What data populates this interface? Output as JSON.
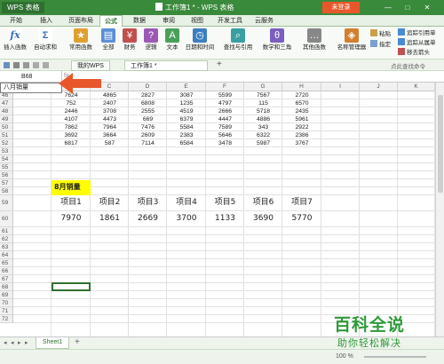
{
  "titlebar": {
    "app": "WPS 表格",
    "title": "工作簿1 * - WPS 表格",
    "login": "未登录",
    "controls": [
      "—",
      "□",
      "✕"
    ],
    "colors": {
      "bar": "#3a8a3c",
      "login": "#e8572b"
    }
  },
  "menu": [
    "开始",
    "插入",
    "页面布局",
    "公式",
    "数据",
    "审阅",
    "视图",
    "开发工具",
    "云服务"
  ],
  "menu_active": "公式",
  "ribbon": {
    "insert_function": "插入函数",
    "autosum": "自动求和",
    "common_functions": "常用函数",
    "all": "全部",
    "finance": "财务",
    "logic": "逻辑",
    "text": "文本",
    "datetime": "日期和时间",
    "lookup": "查找与引用",
    "math_trig": "数学和三角",
    "other_functions": "其他函数",
    "name_manager": "名称管理器",
    "paste": "粘贴",
    "specify": "指定",
    "trace_precedents": "追踪引用单",
    "trace_dependents": "追踪从属单",
    "remove_arrows": "移去箭头"
  },
  "qbar": {
    "tab_wps": "我的WPS",
    "tab_book": "工作簿1 *",
    "new_tab": "+",
    "search_placeholder": "点此查找命令"
  },
  "formula": {
    "namebox": "B68",
    "fx": "fx",
    "dropdown_item": "八月销量"
  },
  "columns": [
    "A",
    "B",
    "C",
    "D",
    "E",
    "F",
    "G",
    "H",
    "I",
    "J",
    "K",
    "L"
  ],
  "data_rows": [
    {
      "row": "46",
      "values": [
        "7624",
        "4865",
        "2827",
        "3087",
        "5599",
        "7567",
        "2720"
      ]
    },
    {
      "row": "47",
      "values": [
        "752",
        "2407",
        "6808",
        "1235",
        "4797",
        "115",
        "6570"
      ]
    },
    {
      "row": "48",
      "values": [
        "2446",
        "3708",
        "2555",
        "4519",
        "2666",
        "5718",
        "2435"
      ]
    },
    {
      "row": "49",
      "values": [
        "4107",
        "4473",
        "669",
        "6379",
        "4447",
        "4886",
        "5961"
      ]
    },
    {
      "row": "50",
      "values": [
        "7862",
        "7964",
        "7476",
        "5584",
        "7589",
        "343",
        "2922"
      ]
    },
    {
      "row": "51",
      "values": [
        "3692",
        "3664",
        "2609",
        "2383",
        "5646",
        "6322",
        "2386"
      ]
    },
    {
      "row": "52",
      "values": [
        "6817",
        "587",
        "7114",
        "6584",
        "3478",
        "5987",
        "3767"
      ]
    }
  ],
  "empty_rows": [
    "53",
    "54",
    "55",
    "56",
    "57",
    "58",
    "59",
    "60",
    "61",
    "62",
    "63",
    "64",
    "65",
    "66",
    "67",
    "68",
    "69",
    "70",
    "71",
    "72"
  ],
  "table": {
    "title": "8月销量",
    "headers": [
      "项目1",
      "项目2",
      "项目3",
      "项目4",
      "项目5",
      "项目6",
      "项目7"
    ],
    "values": [
      "7970",
      "1861",
      "2669",
      "3700",
      "1133",
      "3690",
      "5770"
    ]
  },
  "sheet_tab": "Sheet1",
  "status": {
    "zoom": "100 %"
  },
  "watermark": {
    "line1": "百科全说",
    "line2": "助你轻松解决"
  }
}
